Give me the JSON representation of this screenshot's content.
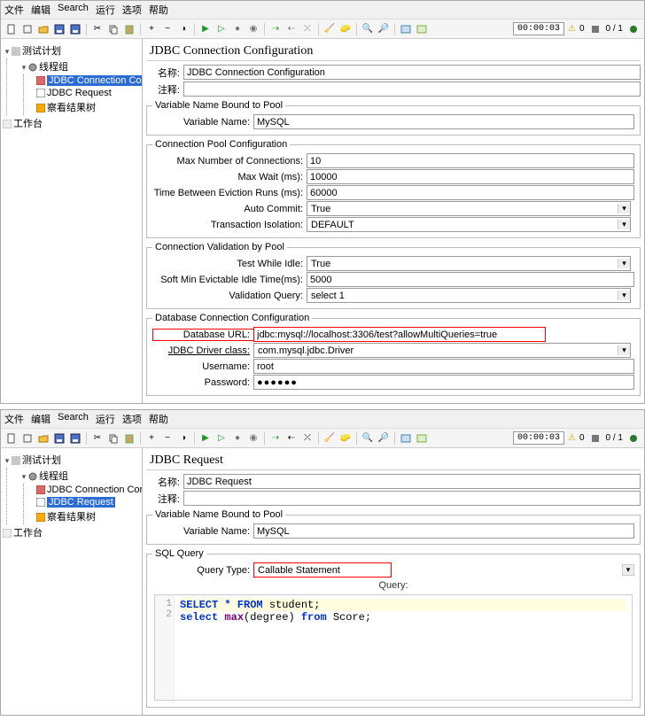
{
  "menubar": {
    "file": "文件",
    "edit": "编辑",
    "search": "Search",
    "run": "运行",
    "options": "选项",
    "help": "帮助"
  },
  "toolbar": {
    "timer": "00:00:03",
    "warn": "0",
    "count": "0 / 1"
  },
  "tree1": {
    "root": "测试计划",
    "thread_group": "线程组",
    "jdbc_conn": "JDBC Connection Configurat",
    "jdbc_req": "JDBC Request",
    "view_results": "察看结果树",
    "workbench": "工作台"
  },
  "jdbc_conn_panel": {
    "title": "JDBC Connection Configuration",
    "name_label": "名称:",
    "name_value": "JDBC Connection Configuration",
    "comment_label": "注释:",
    "comment_value": "",
    "var_bound_legend": "Variable Name Bound to Pool",
    "var_name_label": "Variable Name:",
    "var_name_value": "MySQL",
    "pool_legend": "Connection Pool Configuration",
    "max_conn_label": "Max Number of Connections:",
    "max_conn_value": "10",
    "max_wait_label": "Max Wait (ms):",
    "max_wait_value": "10000",
    "evict_label": "Time Between Eviction Runs (ms):",
    "evict_value": "60000",
    "auto_commit_label": "Auto Commit:",
    "auto_commit_value": "True",
    "tx_iso_label": "Transaction Isolation:",
    "tx_iso_value": "DEFAULT",
    "valid_legend": "Connection Validation by Pool",
    "test_idle_label": "Test While Idle:",
    "test_idle_value": "True",
    "soft_evict_label": "Soft Min Evictable Idle Time(ms):",
    "soft_evict_value": "5000",
    "valid_query_label": "Validation Query:",
    "valid_query_value": "select 1",
    "db_legend": "Database Connection Configuration",
    "db_url_label": "Database URL:",
    "db_url_value": "jdbc:mysql://localhost:3306/test?allowMultiQueries=true",
    "driver_label": "JDBC Driver class:",
    "driver_value": "com.mysql.jdbc.Driver",
    "user_label": "Username:",
    "user_value": "root",
    "pass_label": "Password:",
    "pass_value": "●●●●●●"
  },
  "tree2": {
    "root": "测试计划",
    "thread_group": "线程组",
    "jdbc_conn": "JDBC Connection Configurat",
    "jdbc_req": "JDBC Request",
    "view_results": "察看结果树",
    "workbench": "工作台"
  },
  "jdbc_req_panel": {
    "title": "JDBC Request",
    "name_label": "名称:",
    "name_value": "JDBC Request",
    "comment_label": "注释:",
    "comment_value": "",
    "var_bound_legend": "Variable Name Bound to Pool",
    "var_name_label": "Variable Name:",
    "var_name_value": "MySQL",
    "sql_legend": "SQL Query",
    "query_type_label": "Query Type:",
    "query_type_value": "Callable Statement",
    "query_header": "Query:",
    "sql_line1_prefix": "SELECT * FROM",
    "sql_line1_table": " student;",
    "sql_line2_a": "select ",
    "sql_line2_b": "max",
    "sql_line2_c": "(degree) ",
    "sql_line2_d": "from",
    "sql_line2_e": " Score;"
  }
}
